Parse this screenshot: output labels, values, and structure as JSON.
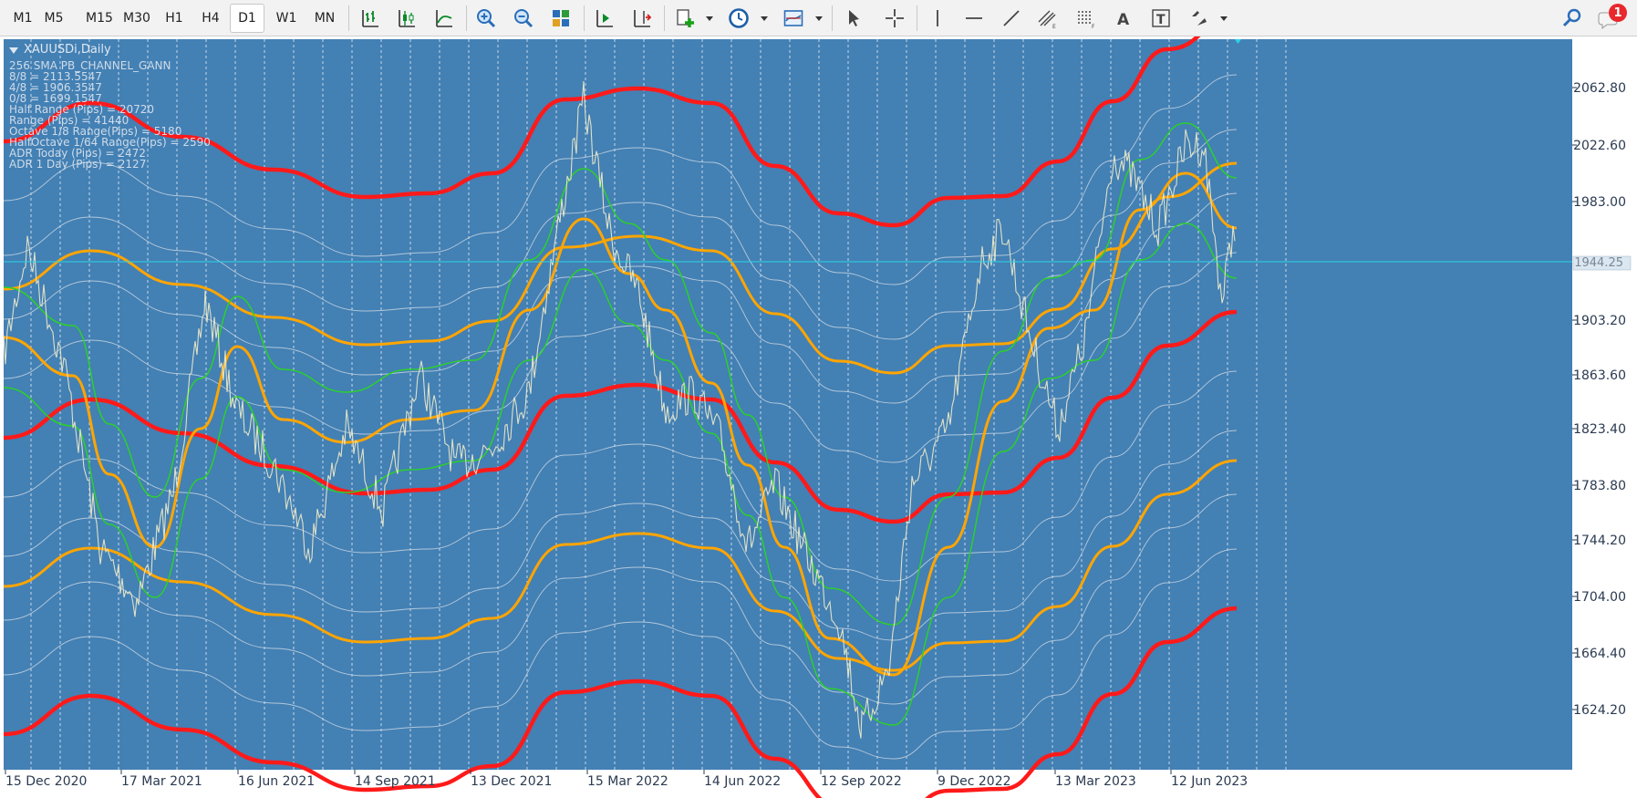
{
  "toolbar": {
    "timeframes": [
      "M1",
      "M5",
      "M15",
      "M30",
      "H1",
      "H4",
      "D1",
      "W1",
      "MN"
    ],
    "active_timeframe": "D1",
    "notification_count": "1"
  },
  "chart": {
    "symbol_title": "XAUUSDi,Daily",
    "indicator_lines": [
      "256 SMA PB_CHANNEL_GANN",
      "8/8 = 2113.5547",
      "4/8 = 1906.3547",
      "0/8 = 1699.1547",
      "Half Range (Pips) = 20720",
      "Range (Pips) = 41440",
      "Octave 1/8 Range(Pips) = 5180",
      "HalfOctave 1/64 Range(Pips) = 2590",
      "ADR Today (Pips) = 2472",
      "ADR 1 Day (Pips) = 2127"
    ],
    "price_labels": [
      "2062.80",
      "2022.60",
      "1983.00",
      "1903.20",
      "1863.60",
      "1823.40",
      "1783.80",
      "1744.20",
      "1704.00",
      "1664.40",
      "1624.20"
    ],
    "current_price": "1944.25",
    "date_labels": [
      "15 Dec 2020",
      "17 Mar 2021",
      "16 Jun 2021",
      "14 Sep 2021",
      "13 Dec 2021",
      "15 Mar 2022",
      "14 Jun 2022",
      "12 Sep 2022",
      "9 Dec 2022",
      "13 Mar 2023",
      "12 Jun 2023"
    ],
    "colors": {
      "background": "#4380b4",
      "red_band": "#ff1a1a",
      "orange_band": "#ffa500",
      "green_band": "#2bd02b",
      "gray_band": "#c5d3e0",
      "price": "#e8e6c8",
      "current_price_line": "#2ad4e6"
    }
  }
}
